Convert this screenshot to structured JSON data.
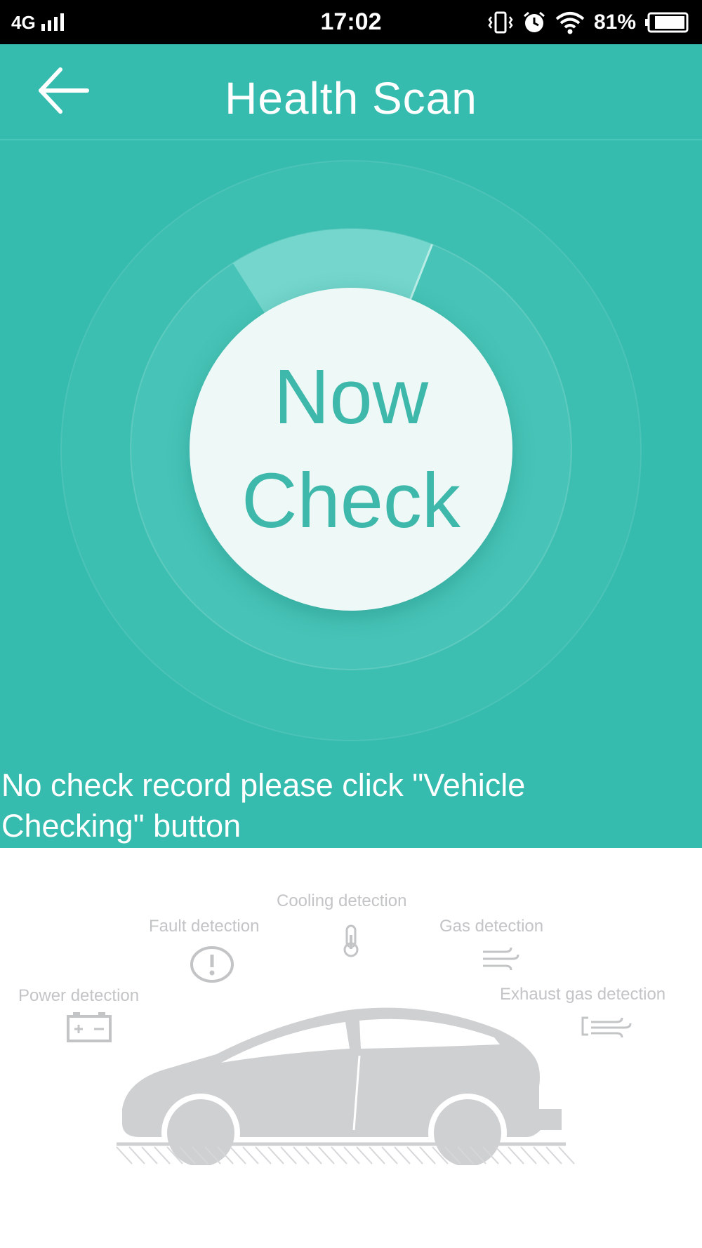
{
  "status_bar": {
    "network": "4G",
    "time": "17:02",
    "battery": "81%"
  },
  "header": {
    "title": "Health Scan"
  },
  "scan": {
    "line1": "Now",
    "line2": "Check",
    "progress_fraction": 0.06,
    "hint": "No check record please click \"Vehicle Checking\" button"
  },
  "detections": {
    "cooling": "Cooling detection",
    "fault": "Fault detection",
    "gas": "Gas detection",
    "power": "Power detection",
    "exhaust": "Exhaust gas detection"
  },
  "icons": {
    "back": "arrow-left-icon",
    "cooling": "thermometer-icon",
    "fault": "exclamation-icon",
    "gas": "wind-icon",
    "power": "battery-icon",
    "exhaust": "exhaust-icon"
  },
  "colors": {
    "brand": "#35bcae",
    "button_text": "#3db8aa",
    "button_bg": "#eef8f6",
    "illustration": "#c3c4c6"
  }
}
